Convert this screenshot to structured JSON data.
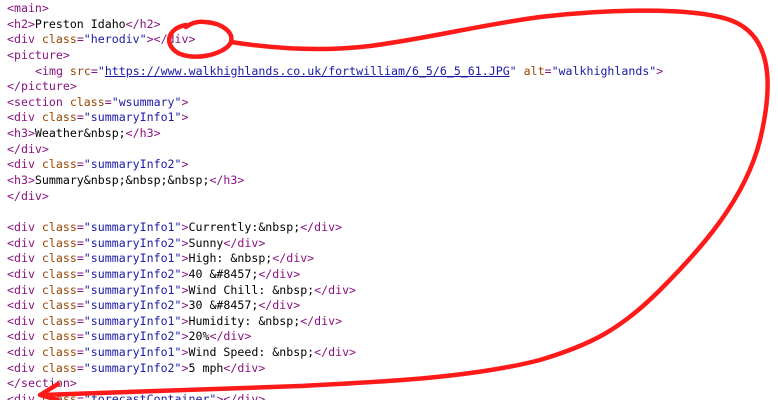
{
  "source": {
    "lines": [
      {
        "indent": 0,
        "parts": [
          [
            "tag",
            "<main>"
          ]
        ]
      },
      {
        "indent": 0,
        "parts": [
          [
            "tag",
            "<h2>"
          ],
          [
            "txt",
            "Preston Idaho"
          ],
          [
            "tag",
            "</h2>"
          ]
        ]
      },
      {
        "indent": 0,
        "parts": [
          [
            "tag",
            "<div "
          ],
          [
            "attr",
            "class"
          ],
          [
            "tag",
            "="
          ],
          [
            "val",
            "\"herodiv\""
          ],
          [
            "tag",
            ">"
          ],
          [
            "tag",
            "</div>"
          ]
        ]
      },
      {
        "indent": 0,
        "parts": [
          [
            "tag",
            "<picture>"
          ]
        ]
      },
      {
        "indent": 1,
        "parts": [
          [
            "tag",
            "<img "
          ],
          [
            "attr",
            "src"
          ],
          [
            "tag",
            "="
          ],
          [
            "val",
            "\""
          ],
          [
            "link",
            "https://www.walkhighlands.co.uk/fortwilliam/6_5/6_5_61.JPG"
          ],
          [
            "val",
            "\""
          ],
          [
            "txt",
            " "
          ],
          [
            "attr",
            "alt"
          ],
          [
            "tag",
            "="
          ],
          [
            "val",
            "\"walkhighlands\""
          ],
          [
            "tag",
            ">"
          ]
        ]
      },
      {
        "indent": 0,
        "parts": [
          [
            "tag",
            "</picture>"
          ]
        ]
      },
      {
        "indent": 0,
        "parts": [
          [
            "tag",
            "<section "
          ],
          [
            "attr",
            "class"
          ],
          [
            "tag",
            "="
          ],
          [
            "val",
            "\"wsummary\""
          ],
          [
            "tag",
            ">"
          ]
        ]
      },
      {
        "indent": 0,
        "parts": [
          [
            "tag",
            "<div "
          ],
          [
            "attr",
            "class"
          ],
          [
            "tag",
            "="
          ],
          [
            "val",
            "\"summaryInfo1\""
          ],
          [
            "tag",
            ">"
          ]
        ]
      },
      {
        "indent": 0,
        "parts": [
          [
            "tag",
            "<h3>"
          ],
          [
            "txt",
            "Weather&nbsp;"
          ],
          [
            "tag",
            "</h3>"
          ]
        ]
      },
      {
        "indent": 0,
        "parts": [
          [
            "tag",
            "</div>"
          ]
        ]
      },
      {
        "indent": 0,
        "parts": [
          [
            "tag",
            "<div "
          ],
          [
            "attr",
            "class"
          ],
          [
            "tag",
            "="
          ],
          [
            "val",
            "\"summaryInfo2\""
          ],
          [
            "tag",
            ">"
          ]
        ]
      },
      {
        "indent": 0,
        "parts": [
          [
            "tag",
            "<h3>"
          ],
          [
            "txt",
            "Summary&nbsp;&nbsp;&nbsp;"
          ],
          [
            "tag",
            "</h3>"
          ]
        ]
      },
      {
        "indent": 0,
        "parts": [
          [
            "tag",
            "</div>"
          ]
        ]
      },
      {
        "indent": 0,
        "parts": []
      },
      {
        "indent": 0,
        "parts": [
          [
            "tag",
            "<div "
          ],
          [
            "attr",
            "class"
          ],
          [
            "tag",
            "="
          ],
          [
            "val",
            "\"summaryInfo1\""
          ],
          [
            "tag",
            ">"
          ],
          [
            "txt",
            "Currently:&nbsp;"
          ],
          [
            "tag",
            "</div>"
          ]
        ]
      },
      {
        "indent": 0,
        "parts": [
          [
            "tag",
            "<div "
          ],
          [
            "attr",
            "class"
          ],
          [
            "tag",
            "="
          ],
          [
            "val",
            "\"summaryInfo2\""
          ],
          [
            "tag",
            ">"
          ],
          [
            "txt",
            "Sunny"
          ],
          [
            "tag",
            "</div>"
          ]
        ]
      },
      {
        "indent": 0,
        "parts": [
          [
            "tag",
            "<div "
          ],
          [
            "attr",
            "class"
          ],
          [
            "tag",
            "="
          ],
          [
            "val",
            "\"summaryInfo1\""
          ],
          [
            "tag",
            ">"
          ],
          [
            "txt",
            "High: &nbsp;"
          ],
          [
            "tag",
            "</div>"
          ]
        ]
      },
      {
        "indent": 0,
        "parts": [
          [
            "tag",
            "<div "
          ],
          [
            "attr",
            "class"
          ],
          [
            "tag",
            "="
          ],
          [
            "val",
            "\"summaryInfo2\""
          ],
          [
            "tag",
            ">"
          ],
          [
            "txt",
            "40 &#8457;"
          ],
          [
            "tag",
            "</div>"
          ]
        ]
      },
      {
        "indent": 0,
        "parts": [
          [
            "tag",
            "<div "
          ],
          [
            "attr",
            "class"
          ],
          [
            "tag",
            "="
          ],
          [
            "val",
            "\"summaryInfo1\""
          ],
          [
            "tag",
            ">"
          ],
          [
            "txt",
            "Wind Chill: &nbsp;"
          ],
          [
            "tag",
            "</div>"
          ]
        ]
      },
      {
        "indent": 0,
        "parts": [
          [
            "tag",
            "<div "
          ],
          [
            "attr",
            "class"
          ],
          [
            "tag",
            "="
          ],
          [
            "val",
            "\"summaryInfo2\""
          ],
          [
            "tag",
            ">"
          ],
          [
            "txt",
            "30 &#8457;"
          ],
          [
            "tag",
            "</div>"
          ]
        ]
      },
      {
        "indent": 0,
        "parts": [
          [
            "tag",
            "<div "
          ],
          [
            "attr",
            "class"
          ],
          [
            "tag",
            "="
          ],
          [
            "val",
            "\"summaryInfo1\""
          ],
          [
            "tag",
            ">"
          ],
          [
            "txt",
            "Humidity: &nbsp;"
          ],
          [
            "tag",
            "</div>"
          ]
        ]
      },
      {
        "indent": 0,
        "parts": [
          [
            "tag",
            "<div "
          ],
          [
            "attr",
            "class"
          ],
          [
            "tag",
            "="
          ],
          [
            "val",
            "\"summaryInfo2\""
          ],
          [
            "tag",
            ">"
          ],
          [
            "txt",
            "20%"
          ],
          [
            "tag",
            "</div>"
          ]
        ]
      },
      {
        "indent": 0,
        "parts": [
          [
            "tag",
            "<div "
          ],
          [
            "attr",
            "class"
          ],
          [
            "tag",
            "="
          ],
          [
            "val",
            "\"summaryInfo1\""
          ],
          [
            "tag",
            ">"
          ],
          [
            "txt",
            "Wind Speed: &nbsp;"
          ],
          [
            "tag",
            "</div>"
          ]
        ]
      },
      {
        "indent": 0,
        "parts": [
          [
            "tag",
            "<div "
          ],
          [
            "attr",
            "class"
          ],
          [
            "tag",
            "="
          ],
          [
            "val",
            "\"summaryInfo2\""
          ],
          [
            "tag",
            ">"
          ],
          [
            "txt",
            "5 mph"
          ],
          [
            "tag",
            "</div>"
          ]
        ]
      },
      {
        "indent": 0,
        "parts": [
          [
            "tag",
            "</section>"
          ]
        ]
      },
      {
        "indent": 0,
        "parts": [
          [
            "tag",
            "<div "
          ],
          [
            "attr",
            "class"
          ],
          [
            "tag",
            "="
          ],
          [
            "val",
            "\"forecastContainer\""
          ],
          [
            "tag",
            ">"
          ],
          [
            "tag",
            "</div>"
          ]
        ]
      }
    ]
  },
  "annotation": {
    "color": "#ff0000",
    "description_shape": "hand-drawn-circle-with-arrow"
  },
  "colors": {
    "tag": "#881280",
    "attribute": "#994500",
    "value": "#1a1aa6",
    "text": "#000000"
  }
}
